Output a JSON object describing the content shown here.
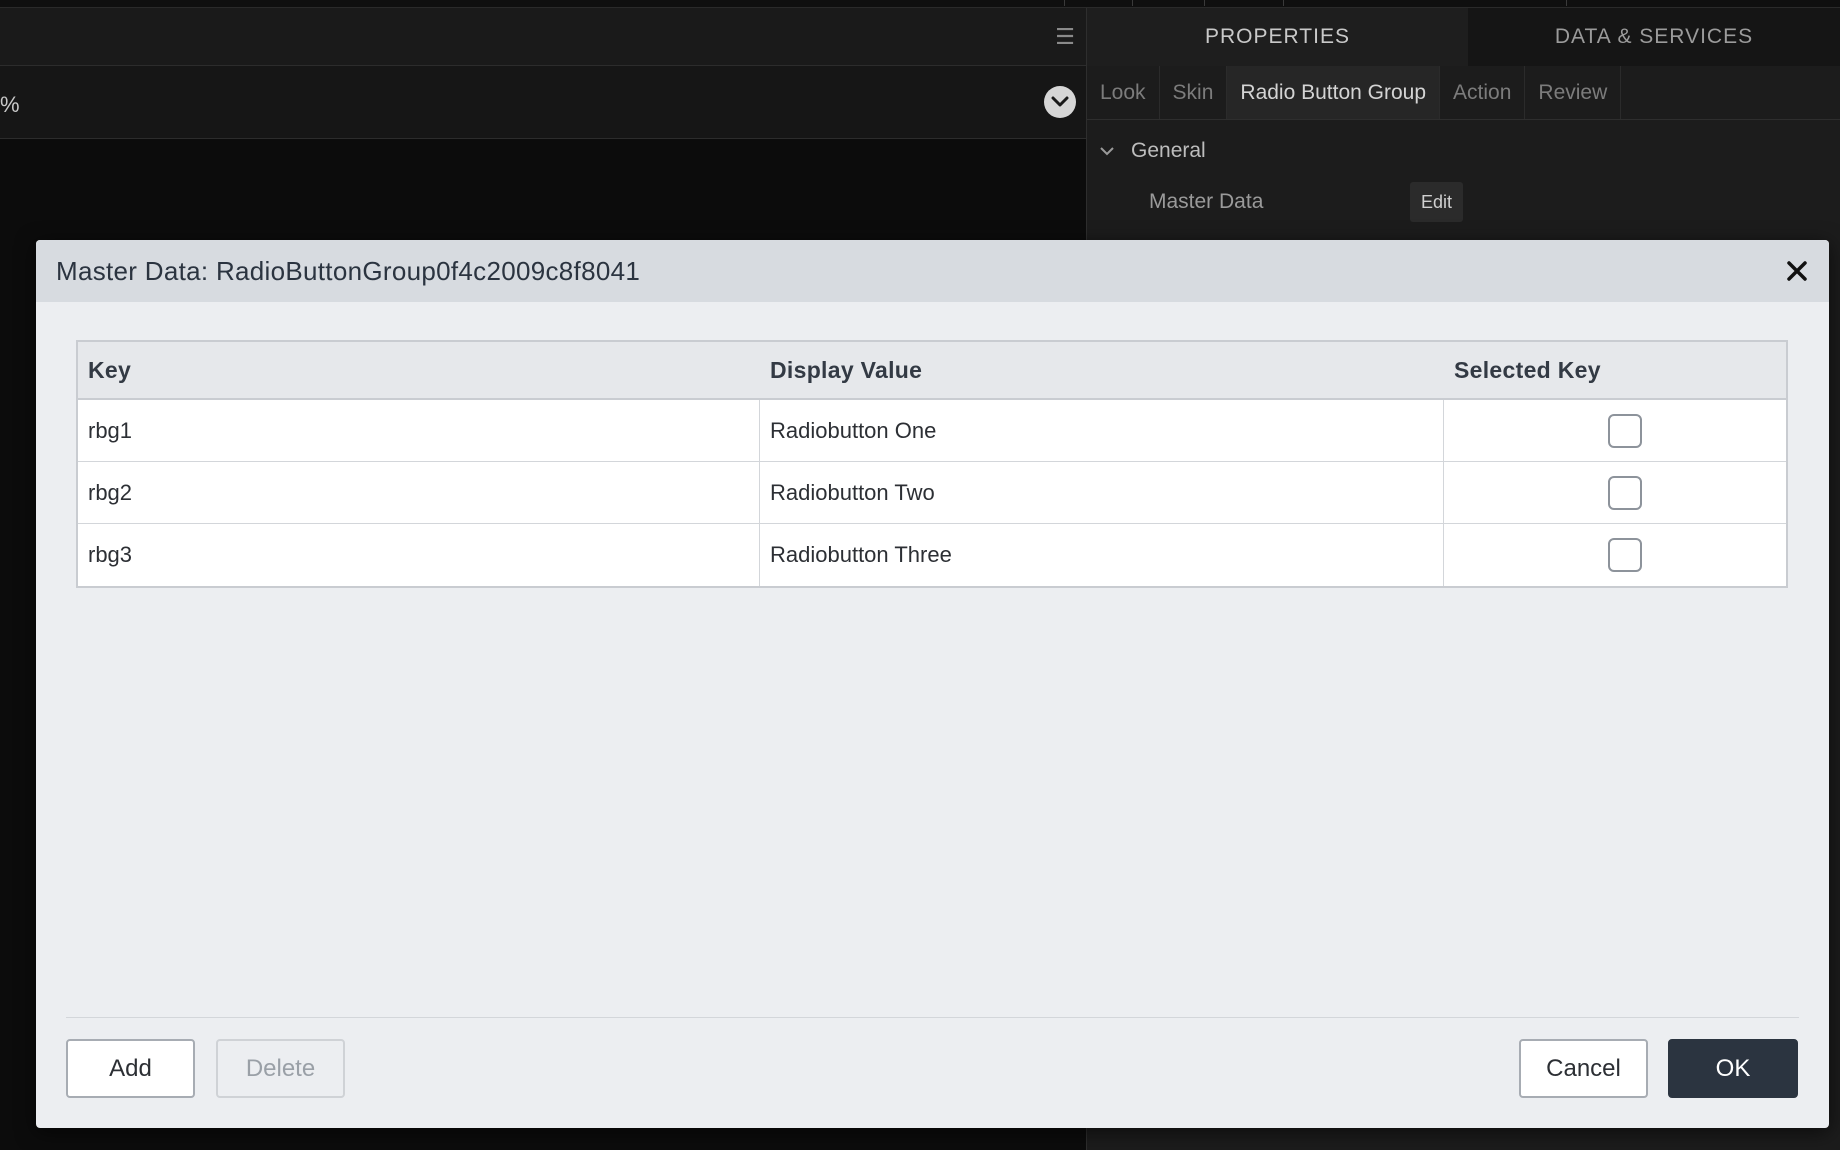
{
  "background": {
    "left_toolbar": {
      "partial_text": "%"
    },
    "right_panel": {
      "tabs": [
        {
          "label": "PROPERTIES",
          "active": true
        },
        {
          "label": "DATA & SERVICES",
          "active": false
        }
      ],
      "subtabs": [
        {
          "label": "Look"
        },
        {
          "label": "Skin"
        },
        {
          "label": "Radio Button Group",
          "active": true
        },
        {
          "label": "Action"
        },
        {
          "label": "Review"
        }
      ],
      "section": {
        "label": "General"
      },
      "row": {
        "label": "Master Data",
        "button": "Edit"
      }
    }
  },
  "modal": {
    "title": "Master Data: RadioButtonGroup0f4c2009c8f8041",
    "columns": [
      "Key",
      "Display Value",
      "Selected Key"
    ],
    "rows": [
      {
        "key": "rbg1",
        "display": "Radiobutton One",
        "selected": false
      },
      {
        "key": "rbg2",
        "display": "Radiobutton Two",
        "selected": false
      },
      {
        "key": "rbg3",
        "display": "Radiobutton Three",
        "selected": false
      }
    ],
    "buttons": {
      "add": "Add",
      "delete": "Delete",
      "cancel": "Cancel",
      "ok": "OK"
    }
  },
  "colors": {
    "modal_header_bg": "#d7dbe0",
    "modal_body_bg": "#eceef1",
    "primary_button": "#2b3440",
    "app_dark_bg": "#0b0b0b"
  }
}
